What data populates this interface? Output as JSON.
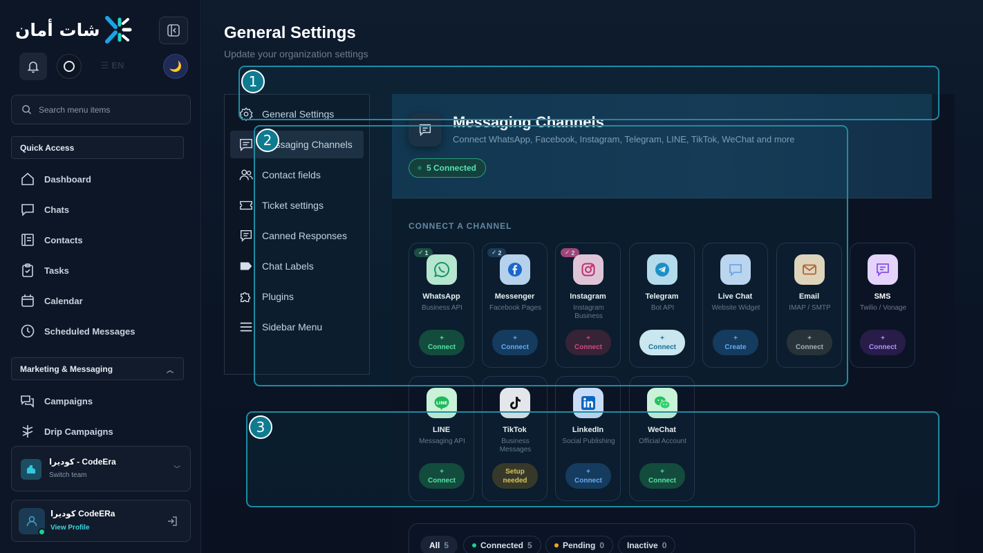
{
  "app": {
    "logo_text": "شات أمان",
    "lang": "EN",
    "search_placeholder": "Search menu items"
  },
  "sidebar": {
    "quick_access_label": "Quick Access",
    "quick_items": [
      {
        "label": "Dashboard",
        "icon": "home-icon"
      },
      {
        "label": "Chats",
        "icon": "chat-icon"
      },
      {
        "label": "Contacts",
        "icon": "contacts-icon"
      },
      {
        "label": "Tasks",
        "icon": "clipboard-icon"
      },
      {
        "label": "Calendar",
        "icon": "calendar-icon"
      },
      {
        "label": "Scheduled Messages",
        "icon": "clock-icon"
      }
    ],
    "marketing_label": "Marketing & Messaging",
    "marketing_items": [
      {
        "label": "Campaigns",
        "icon": "campaign-icon"
      },
      {
        "label": "Drip Campaigns",
        "icon": "drip-icon"
      }
    ],
    "team": {
      "name": "كوديرا - CodeEra",
      "sub": "Switch team"
    },
    "profile": {
      "name": "كوديرا CodeERa",
      "link": "View Profile"
    }
  },
  "page": {
    "title": "General Settings",
    "subtitle": "Update your organization settings"
  },
  "settings_nav": [
    {
      "label": "General Settings",
      "icon": "gear-icon"
    },
    {
      "label": "Messaging Channels",
      "icon": "message-icon"
    },
    {
      "label": "Contact fields",
      "icon": "users-icon"
    },
    {
      "label": "Ticket settings",
      "icon": "ticket-icon"
    },
    {
      "label": "Canned Responses",
      "icon": "canned-icon"
    },
    {
      "label": "Chat Labels",
      "icon": "label-icon"
    },
    {
      "label": "Plugins",
      "icon": "puzzle-icon"
    },
    {
      "label": "Sidebar Menu",
      "icon": "menu-icon"
    }
  ],
  "hero": {
    "title": "Messaging Channels",
    "description": "Connect WhatsApp, Facebook, Instagram, Telegram, LINE, TikTok, WeChat and more",
    "badge": "5 Connected"
  },
  "connect_heading": "CONNECT A CHANNEL",
  "channels": [
    {
      "name": "WhatsApp",
      "desc": "Business API",
      "count": "1",
      "btn_top": "+",
      "btn_label": "Connect",
      "icon": "whatsapp-icon"
    },
    {
      "name": "Messenger",
      "desc": "Facebook Pages",
      "count": "2",
      "btn_top": "+",
      "btn_label": "Connect",
      "icon": "messenger-icon"
    },
    {
      "name": "Instagram",
      "desc": "Instagram Business",
      "count": "2",
      "btn_top": "+",
      "btn_label": "Connect",
      "icon": "instagram-icon"
    },
    {
      "name": "Telegram",
      "desc": "Bot API",
      "btn_top": "+",
      "btn_label": "Connect",
      "icon": "telegram-icon"
    },
    {
      "name": "Live Chat",
      "desc": "Website Widget",
      "btn_top": "+",
      "btn_label": "Create",
      "icon": "livechat-icon"
    },
    {
      "name": "Email",
      "desc": "IMAP / SMTP",
      "btn_top": "+",
      "btn_label": "Connect",
      "icon": "email-icon"
    },
    {
      "name": "SMS",
      "desc": "Twilio / Vonage",
      "btn_top": "+",
      "btn_label": "Connect",
      "icon": "sms-icon"
    },
    {
      "name": "LINE",
      "desc": "Messaging API",
      "btn_top": "+",
      "btn_label": "Connect",
      "icon": "line-icon"
    },
    {
      "name": "TikTok",
      "desc": "Business Messages",
      "btn_top": "Setup",
      "btn_label": "needed",
      "icon": "tiktok-icon"
    },
    {
      "name": "LinkedIn",
      "desc": "Social Publishing",
      "btn_top": "+",
      "btn_label": "Connect",
      "icon": "linkedin-icon"
    },
    {
      "name": "WeChat",
      "desc": "Official Account",
      "btn_top": "+",
      "btn_label": "Connect",
      "icon": "wechat-icon"
    }
  ],
  "filters": [
    {
      "label": "All",
      "count": "5"
    },
    {
      "label": "Connected",
      "count": "5"
    },
    {
      "label": "Pending",
      "count": "0"
    },
    {
      "label": "Inactive",
      "count": "0"
    }
  ],
  "annotations": [
    "1",
    "2",
    "3"
  ]
}
